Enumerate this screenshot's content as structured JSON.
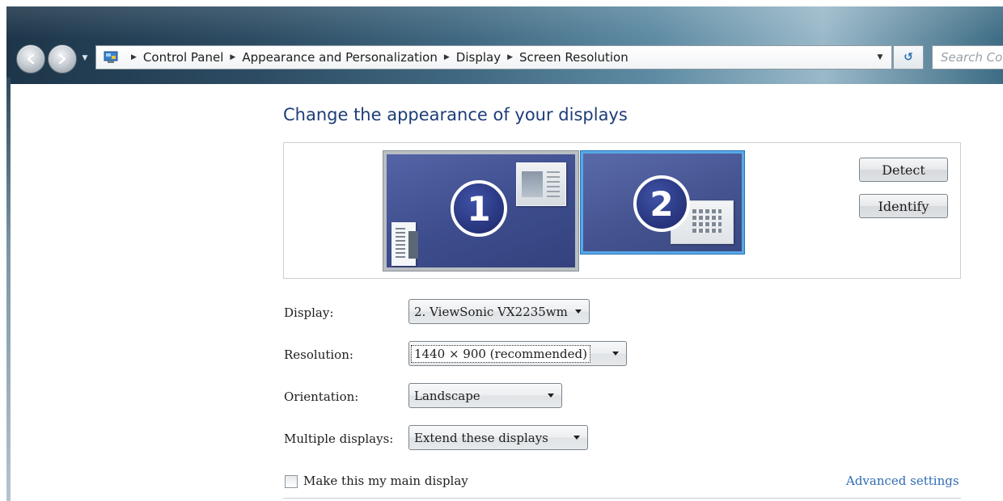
{
  "navigation": {
    "back_icon": "back-arrow-icon",
    "forward_icon": "forward-arrow-icon",
    "breadcrumbs": [
      "Control Panel",
      "Appearance and Personalization",
      "Display",
      "Screen Resolution"
    ],
    "refresh_glyph": "↺",
    "search_placeholder": "Search Control Panel"
  },
  "page": {
    "title": "Change the appearance of your displays"
  },
  "monitors": [
    {
      "number": "1",
      "selected": false
    },
    {
      "number": "2",
      "selected": true
    }
  ],
  "buttons": {
    "detect": "Detect",
    "identify": "Identify"
  },
  "form": {
    "display_label": "Display:",
    "display_value": "2. ViewSonic VX2235wm",
    "resolution_label": "Resolution:",
    "resolution_value": "1440 × 900 (recommended)",
    "orientation_label": "Orientation:",
    "orientation_value": "Landscape",
    "multiple_label": "Multiple displays:",
    "multiple_value": "Extend these displays"
  },
  "main_display": {
    "label": "Make this my main display",
    "checked": false
  },
  "advanced_link": "Advanced settings",
  "colors": {
    "title_blue": "#1e3d78",
    "link_blue": "#2e6bb4",
    "selected_border": "#57a8e5"
  }
}
